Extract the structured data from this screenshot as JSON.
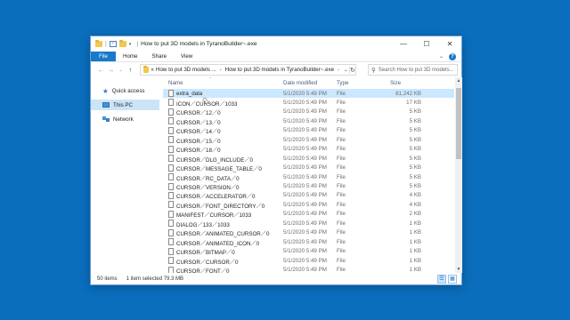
{
  "window": {
    "title": "How to put 3D models in TyranoBuilder~.exe",
    "title_sep": "|",
    "controls": {
      "minimize": "—",
      "maximize": "☐",
      "close": "✕"
    }
  },
  "ribbon": {
    "tabs": [
      "File",
      "Home",
      "Share",
      "View"
    ],
    "expand_icon": "chevron-down-icon",
    "help_label": "?"
  },
  "address": {
    "prefix": "«",
    "crumbs": [
      "How to put 3D models ...",
      "How to put 3D models in TyranoBuilder~.exe"
    ],
    "search_placeholder": "Search How to put 3D models..."
  },
  "nav": {
    "items": [
      {
        "label": "Quick access",
        "icon": "star-icon"
      },
      {
        "label": "This PC",
        "icon": "computer-icon"
      },
      {
        "label": "Network",
        "icon": "network-icon"
      }
    ],
    "selected": "This PC"
  },
  "columns": {
    "name": "Name",
    "date": "Date modified",
    "type": "Type",
    "size": "Size"
  },
  "files": [
    {
      "name": "extra_data",
      "date": "5/1/2020 5:49 PM",
      "type": "File",
      "size": "81,242 KB"
    },
    {
      "name": "ICON／CURSOR／1033",
      "date": "5/1/2020 5:49 PM",
      "type": "File",
      "size": "17 KB"
    },
    {
      "name": "CURSOR／12／0",
      "date": "5/1/2020 5:49 PM",
      "type": "File",
      "size": "5 KB"
    },
    {
      "name": "CURSOR／13／0",
      "date": "5/1/2020 5:49 PM",
      "type": "File",
      "size": "5 KB"
    },
    {
      "name": "CURSOR／14／0",
      "date": "5/1/2020 5:49 PM",
      "type": "File",
      "size": "5 KB"
    },
    {
      "name": "CURSOR／15／0",
      "date": "5/1/2020 5:49 PM",
      "type": "File",
      "size": "5 KB"
    },
    {
      "name": "CURSOR／18／0",
      "date": "5/1/2020 5:49 PM",
      "type": "File",
      "size": "5 KB"
    },
    {
      "name": "CURSOR／DLG_INCLUDE／0",
      "date": "5/1/2020 5:49 PM",
      "type": "File",
      "size": "5 KB"
    },
    {
      "name": "CURSOR／MESSAGE_TABLE／0",
      "date": "5/1/2020 5:49 PM",
      "type": "File",
      "size": "5 KB"
    },
    {
      "name": "CURSOR／RC_DATA／0",
      "date": "5/1/2020 5:49 PM",
      "type": "File",
      "size": "5 KB"
    },
    {
      "name": "CURSOR／VERSION／0",
      "date": "5/1/2020 5:49 PM",
      "type": "File",
      "size": "5 KB"
    },
    {
      "name": "CURSOR／ACCELERATOR／0",
      "date": "5/1/2020 5:49 PM",
      "type": "File",
      "size": "4 KB"
    },
    {
      "name": "CURSOR／FONT_DIRECTORY／0",
      "date": "5/1/2020 5:49 PM",
      "type": "File",
      "size": "4 KB"
    },
    {
      "name": "MANIFEST／CURSOR／1033",
      "date": "5/1/2020 5:49 PM",
      "type": "File",
      "size": "2 KB"
    },
    {
      "name": "DIALOG／133／1033",
      "date": "5/1/2020 5:49 PM",
      "type": "File",
      "size": "1 KB"
    },
    {
      "name": "CURSOR／ANIMATED_CURSOR／0",
      "date": "5/1/2020 5:49 PM",
      "type": "File",
      "size": "1 KB"
    },
    {
      "name": "CURSOR／ANIMATED_ICON／0",
      "date": "5/1/2020 5:49 PM",
      "type": "File",
      "size": "1 KB"
    },
    {
      "name": "CURSOR／BITMAP／0",
      "date": "5/1/2020 5:49 PM",
      "type": "File",
      "size": "1 KB"
    },
    {
      "name": "CURSOR／CURSOR／0",
      "date": "5/1/2020 5:49 PM",
      "type": "File",
      "size": "1 KB"
    },
    {
      "name": "CURSOR／FONT／0",
      "date": "5/1/2020 5:49 PM",
      "type": "File",
      "size": "1 KB"
    }
  ],
  "selected_file": "extra_data",
  "status": {
    "items": "50 items",
    "selection": "1 item selected  79.3 MB"
  },
  "colors": {
    "desktop": "#0a6ebd",
    "accent": "#1979ca",
    "selection": "#cce8ff"
  }
}
